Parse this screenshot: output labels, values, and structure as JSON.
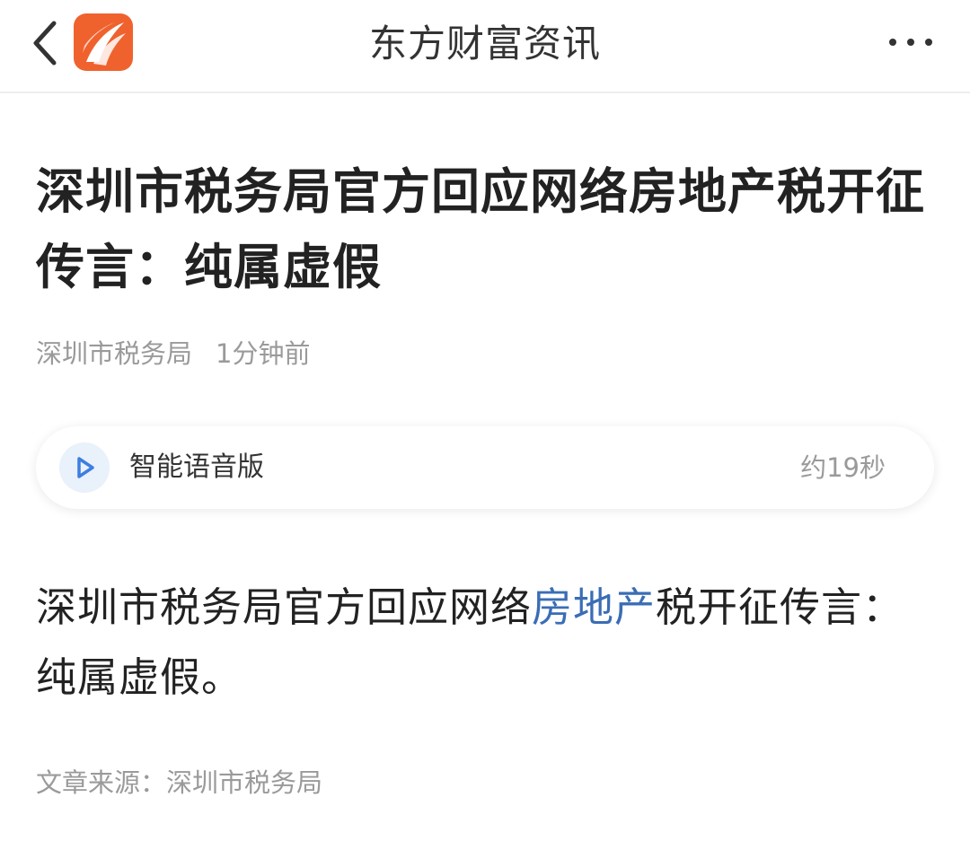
{
  "header": {
    "title": "东方财富资讯",
    "back_icon": "chevron-left-icon",
    "more_icon": "more-horizontal-icon",
    "logo_color": "#f0622d"
  },
  "article": {
    "headline": "深圳市税务局官方回应网络房地产税开征传言：纯属虚假",
    "author": "深圳市税务局",
    "time": "1分钟前",
    "audio": {
      "label": "智能语音版",
      "duration": "约19秒",
      "icon": "play-icon"
    },
    "body": {
      "before_link": "深圳市税务局官方回应网络",
      "link": "房地产",
      "after_link": "税开征传言：纯属虚假。"
    },
    "source": "文章来源：深圳市税务局",
    "link_color": "#3a6db5"
  }
}
